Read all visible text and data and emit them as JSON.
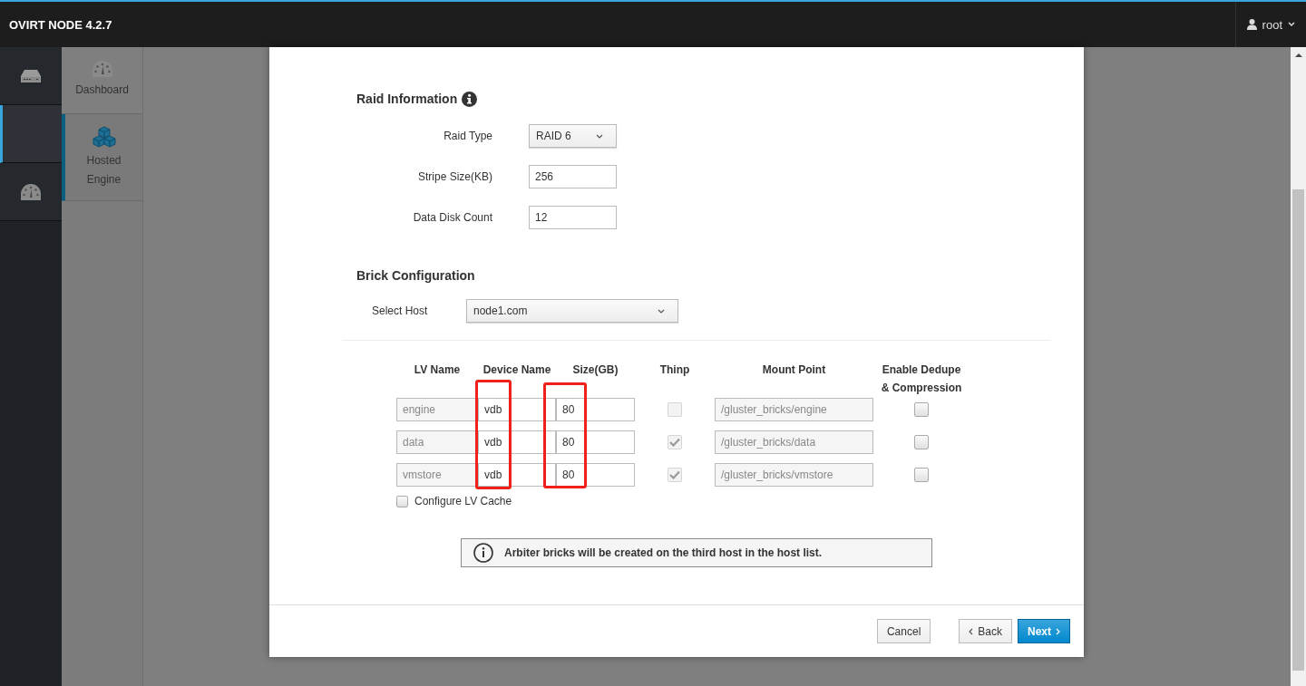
{
  "header": {
    "brand": "OVIRT NODE 4.2.7",
    "user": "root"
  },
  "nav": [
    {
      "kind": "server",
      "selected": false
    },
    {
      "kind": "blank",
      "selected": true
    },
    {
      "kind": "gauge",
      "selected": false
    }
  ],
  "subnav": [
    {
      "label": "Dashboard",
      "kind": "gauge",
      "selected": false
    },
    {
      "label": "Hosted Engine",
      "kind": "cubes",
      "selected": true
    }
  ],
  "raid": {
    "title": "Raid Information",
    "fields": [
      {
        "label": "Raid Type",
        "kind": "select",
        "value": "RAID 6"
      },
      {
        "label": "Stripe Size(KB)",
        "kind": "text",
        "value": "256"
      },
      {
        "label": "Data Disk Count",
        "kind": "text",
        "value": "12"
      }
    ]
  },
  "brick": {
    "title": "Brick Configuration",
    "host_label": "Select Host",
    "host_value": "node1.com",
    "columns": [
      {
        "label": "LV Name",
        "highlighted": false
      },
      {
        "label": "Device Name",
        "highlighted": true
      },
      {
        "label": "Size(GB)",
        "highlighted": true
      },
      {
        "label": "Thinp",
        "highlighted": false
      },
      {
        "label": "Mount Point",
        "highlighted": false
      },
      {
        "label": "Enable Dedupe & Compression",
        "highlighted": false
      }
    ],
    "rows": [
      {
        "lv_name": "engine",
        "device": "vdb",
        "size": "80",
        "thinp": false,
        "mount_point": "/gluster_bricks/engine",
        "dedupe": false
      },
      {
        "lv_name": "data",
        "device": "vdb",
        "size": "80",
        "thinp": true,
        "mount_point": "/gluster_bricks/data",
        "dedupe": false
      },
      {
        "lv_name": "vmstore",
        "device": "vdb",
        "size": "80",
        "thinp": true,
        "mount_point": "/gluster_bricks/vmstore",
        "dedupe": false
      }
    ],
    "lv_cache": {
      "label": "Configure LV Cache",
      "checked": false
    }
  },
  "alert": "Arbiter bricks will be created on the third host in the host list.",
  "buttons": [
    {
      "label": "Cancel",
      "kind": "default"
    },
    {
      "label": "Back",
      "kind": "back"
    },
    {
      "label": "Next",
      "kind": "primary"
    }
  ]
}
